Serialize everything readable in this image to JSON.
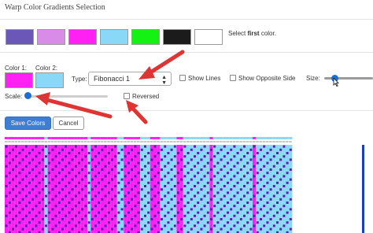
{
  "title": "Warp Color Gradients Selection",
  "swatches": [
    {
      "name": "color-swatch-purple",
      "color": "#6a57b7"
    },
    {
      "name": "color-swatch-violet",
      "color": "#d98be8"
    },
    {
      "name": "color-swatch-magenta",
      "color": "#ff20f4"
    },
    {
      "name": "color-swatch-light-blue",
      "color": "#8ad8f7"
    },
    {
      "name": "color-swatch-green",
      "color": "#13f213"
    },
    {
      "name": "color-swatch-black",
      "color": "#1b1b1b"
    },
    {
      "name": "color-swatch-white",
      "color": "#ffffff"
    }
  ],
  "instruction": {
    "before": "Select ",
    "bold": "first",
    "after": " color."
  },
  "color1": {
    "label": "Color 1:",
    "color": "#ff20f4"
  },
  "color2": {
    "label": "Color 2:",
    "color": "#8ad8f7"
  },
  "type": {
    "label": "Type:",
    "value": "Fibonacci 1"
  },
  "show_lines": {
    "label": "Show Lines",
    "checked": false
  },
  "show_opposite": {
    "label": "Show Opposite Side",
    "checked": false
  },
  "size": {
    "label": "Size:"
  },
  "scale": {
    "label": "Scale:"
  },
  "reversed": {
    "label": "Reversed",
    "checked": false
  },
  "buttons": {
    "save": "Save Colors",
    "cancel": "Cancel"
  },
  "colors": {
    "accent": "#1b6fd1",
    "annotation_arrow": "#e03333",
    "pattern_a": "#ff20f4",
    "pattern_b": "#8ad8f7",
    "pattern_dark": "#5a1fb0"
  },
  "preview": {
    "stripes": [
      {
        "color": "magenta",
        "count": 12
      },
      {
        "color": "blue",
        "count": 1
      },
      {
        "color": "magenta",
        "count": 12
      },
      {
        "color": "blue",
        "count": 1
      },
      {
        "color": "magenta",
        "count": 8
      },
      {
        "color": "blue",
        "count": 2
      },
      {
        "color": "magenta",
        "count": 5
      },
      {
        "color": "blue",
        "count": 3
      },
      {
        "color": "magenta",
        "count": 3
      },
      {
        "color": "blue",
        "count": 5
      },
      {
        "color": "magenta",
        "count": 2
      },
      {
        "color": "blue",
        "count": 8
      },
      {
        "color": "magenta",
        "count": 1
      },
      {
        "color": "blue",
        "count": 12
      },
      {
        "color": "magenta",
        "count": 1
      },
      {
        "color": "blue",
        "count": 11
      }
    ]
  }
}
